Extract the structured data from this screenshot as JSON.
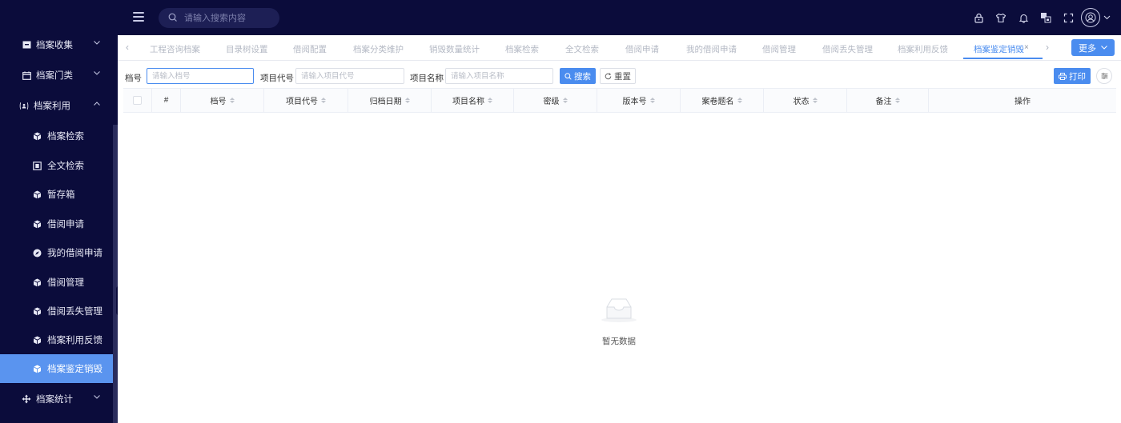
{
  "header": {
    "search_placeholder": "请输入搜索内容",
    "icons": [
      "lock-icon",
      "shirt-icon",
      "bell-icon",
      "translate-icon",
      "fullscreen-icon",
      "avatar-icon",
      "chevron-down-icon"
    ]
  },
  "sidebar": {
    "groups": [
      {
        "label": "档案收集",
        "icon": "archive-box-icon"
      },
      {
        "label": "档案门类",
        "icon": "calendar-icon"
      },
      {
        "label": "档案利用",
        "icon": "user-badge-icon"
      },
      {
        "label": "档案统计",
        "icon": "move-icon"
      }
    ],
    "items": [
      {
        "label": "档案检索",
        "icon": "cube-icon"
      },
      {
        "label": "全文检索",
        "icon": "document-icon"
      },
      {
        "label": "暂存箱",
        "icon": "cube-icon"
      },
      {
        "label": "借阅申请",
        "icon": "cube-icon"
      },
      {
        "label": "我的借阅申请",
        "icon": "compass-icon"
      },
      {
        "label": "借阅管理",
        "icon": "cube-icon"
      },
      {
        "label": "借阅丢失管理",
        "icon": "cube-icon"
      },
      {
        "label": "档案利用反馈",
        "icon": "cube-icon"
      },
      {
        "label": "档案鉴定销毁",
        "icon": "cube-icon",
        "active": true
      }
    ]
  },
  "tabs": {
    "items": [
      "工程咨询档案",
      "目录树设置",
      "借阅配置",
      "档案分类维护",
      "销毁数量统计",
      "档案检索",
      "全文检索",
      "借阅申请",
      "我的借阅申请",
      "借阅管理",
      "借阅丢失管理",
      "档案利用反馈",
      "档案鉴定销毁"
    ],
    "active": "档案鉴定销毁",
    "more_label": "更多"
  },
  "filters": {
    "archive_no_label": "档号",
    "archive_no_placeholder": "请输入档号",
    "project_code_label": "项目代号",
    "project_code_placeholder": "请输入项目代号",
    "project_name_label": "项目名称",
    "project_name_placeholder": "请输入项目名称",
    "search_label": "搜索",
    "reset_label": "重置",
    "print_label": "打印"
  },
  "table": {
    "columns": [
      "#",
      "档号",
      "项目代号",
      "归档日期",
      "项目名称",
      "密级",
      "版本号",
      "案卷题名",
      "状态",
      "备注",
      "操作"
    ],
    "rows": [],
    "empty_text": "暂无数据"
  },
  "colors": {
    "sidebar_bg": "#0b0c3b",
    "accent": "#4a8cef",
    "active_item": "#5a94ef"
  }
}
